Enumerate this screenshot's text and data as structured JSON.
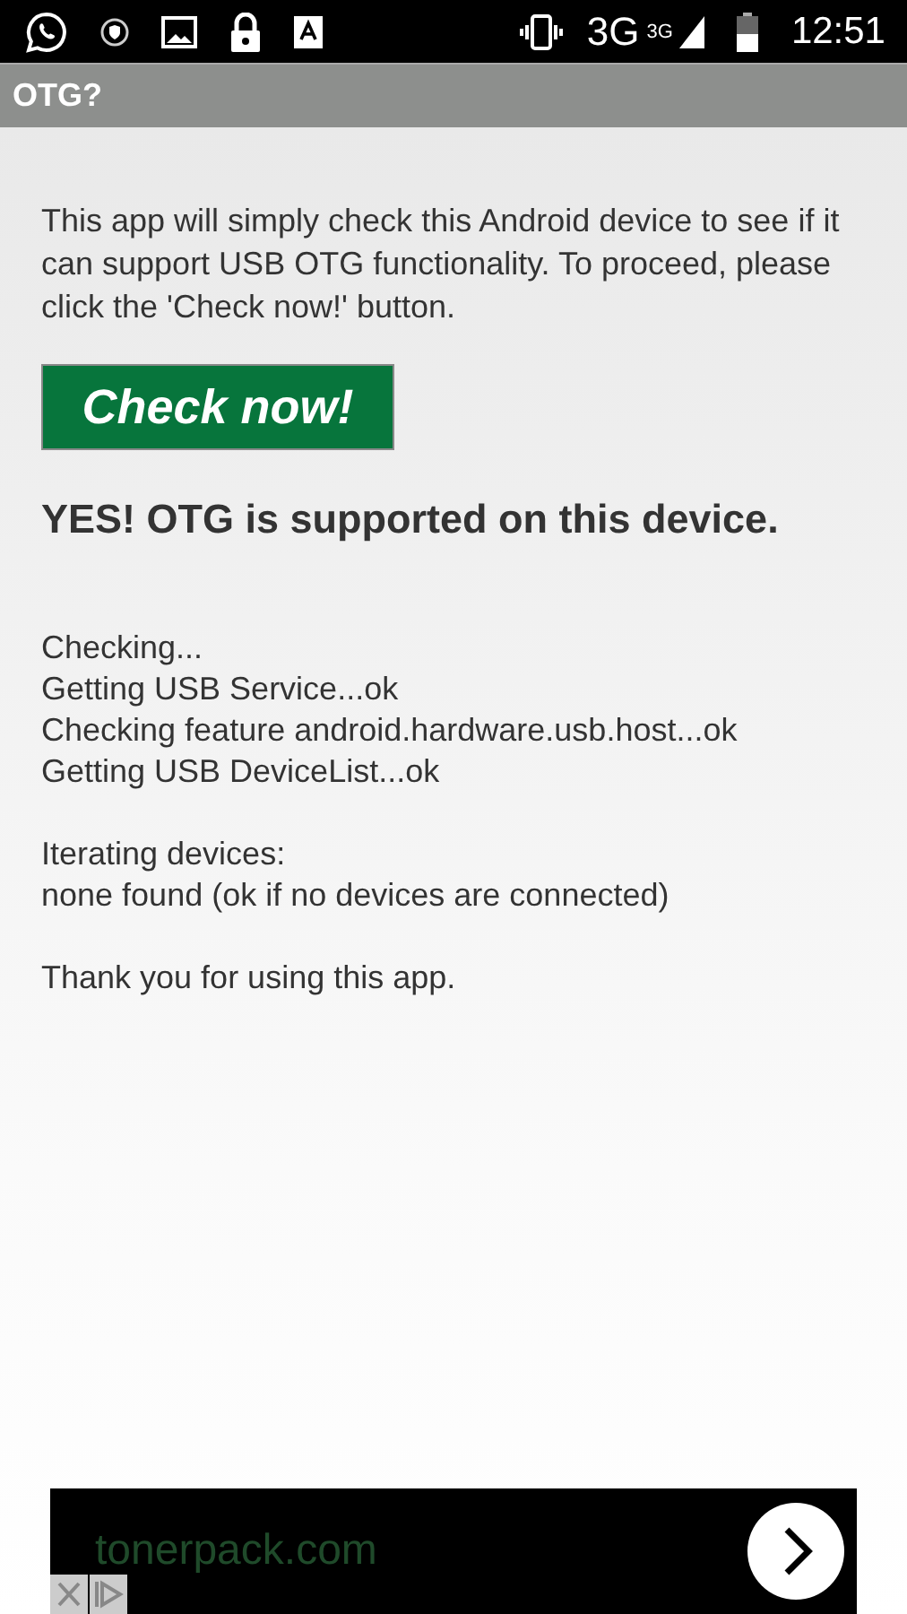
{
  "status_bar": {
    "network": "3G",
    "network_small": "3G",
    "time": "12:51"
  },
  "app_bar": {
    "title": "OTG?"
  },
  "intro": "This app will simply check this Android device to see if it can support USB OTG functionality. To proceed, please click the 'Check now!' button.",
  "check_button": "Check now!",
  "result": "YES! OTG is supported on this device.",
  "log_groups": [
    [
      "Checking...",
      "Getting USB Service...ok",
      "Checking feature android.hardware.usb.host...ok",
      "Getting USB DeviceList...ok"
    ],
    [
      "Iterating devices:",
      "none found (ok if no devices are connected)"
    ],
    [
      "Thank you for using this app."
    ]
  ],
  "ad": {
    "text": "tonerpack.com"
  }
}
